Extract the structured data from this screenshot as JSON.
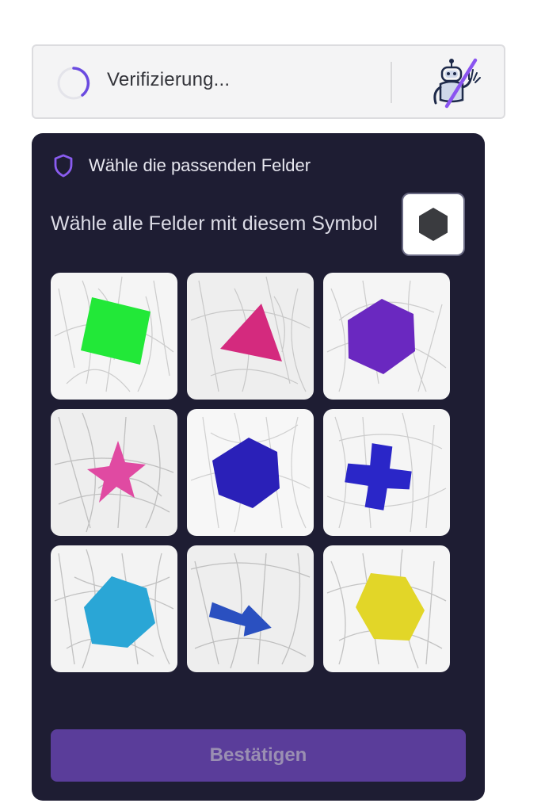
{
  "verify": {
    "status_text": "Verifizierung..."
  },
  "panel": {
    "header": "Wähle die passenden Felder",
    "instruction": "Wähle alle Felder mit diesem Symbol",
    "target_symbol": "hexagon",
    "target_color": "#3a3b3f",
    "confirm_label": "Bestätigen"
  },
  "colors": {
    "panel_bg": "#1e1d33",
    "accent": "#7b4bd6",
    "button_bg": "#5a3d9a",
    "button_text": "#9a8fb2"
  },
  "tiles": [
    {
      "shape": "square",
      "color": "#22e838"
    },
    {
      "shape": "triangle",
      "color": "#d42a7e"
    },
    {
      "shape": "hexagon",
      "color": "#6a28c0"
    },
    {
      "shape": "star",
      "color": "#e04aa2"
    },
    {
      "shape": "hexagon",
      "color": "#2a20b8"
    },
    {
      "shape": "cross",
      "color": "#2a26c8"
    },
    {
      "shape": "hexagon",
      "color": "#2aa6d6"
    },
    {
      "shape": "arrow",
      "color": "#2a50c0"
    },
    {
      "shape": "hexagon",
      "color": "#e2d628"
    }
  ]
}
